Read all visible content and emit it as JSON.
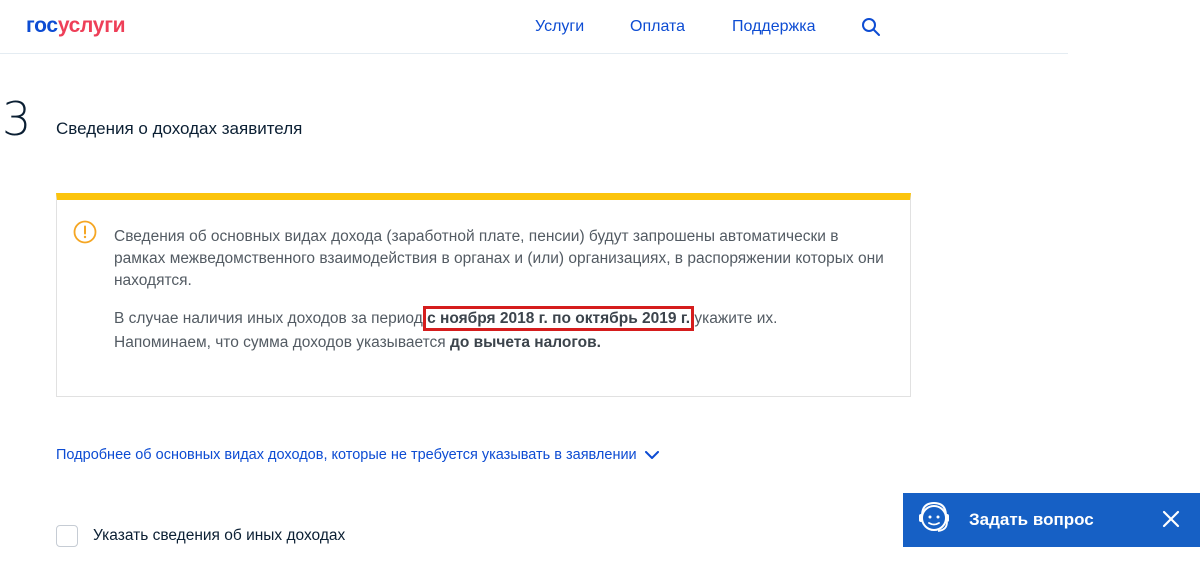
{
  "header": {
    "logo_part1": "гос",
    "logo_part2": "услуги",
    "nav": [
      "Услуги",
      "Оплата",
      "Поддержка"
    ],
    "icons": {
      "search": "search-icon"
    }
  },
  "step": {
    "number": "3",
    "title": "Сведения о доходах заявителя"
  },
  "info_box": {
    "icon": "warning-circle-icon",
    "accent_color": "#fcc40c",
    "paragraph1": "Сведения об основных видах дохода (заработной плате, пенсии) будут запрошены автоматически в рамках межведомственного взаимодействия в органах и (или) организациях, в распоряжении которых они находятся.",
    "paragraph2_before": "В случае наличия иных доходов за период ",
    "paragraph2_period": "с ноября 2018 г. по октябрь 2019 г.",
    "paragraph2_after": " укажите их.",
    "paragraph3_before": "Напоминаем, что сумма доходов указывается ",
    "paragraph3_bold": "до вычета налогов."
  },
  "more_link": {
    "text": "Подробнее об основных видах доходов, которые не требуется указывать в заявлении",
    "icon": "chevron-down-icon"
  },
  "checkbox": {
    "label": "Указать сведения об иных доходах",
    "checked": false
  },
  "ask_widget": {
    "label": "Задать вопрос",
    "icon": "support-operator-icon",
    "close_icon": "close-icon",
    "background": "#1660c5"
  }
}
